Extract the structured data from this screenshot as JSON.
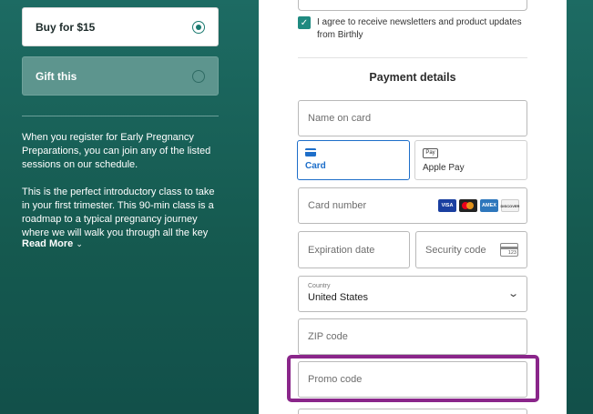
{
  "purchase_options": {
    "buy_label": "Buy for $15",
    "gift_label": "Gift this"
  },
  "description": {
    "paragraph1": "When you register for Early Pregnancy Preparations, you can join any of the listed sessions on our schedule.",
    "paragraph2": "This is the perfect introductory class to take in your first trimester. This 90-min class is a roadmap to a typical pregnancy journey where we will walk you through all the key",
    "read_more": "Read More"
  },
  "newsletter": {
    "checked": true,
    "text": "I agree to receive newsletters and product updates from Birthly"
  },
  "payment": {
    "title": "Payment details",
    "name_placeholder": "Name on card",
    "methods": [
      {
        "label": "Card",
        "selected": true,
        "icon": "credit-card-icon"
      },
      {
        "label": "Apple Pay",
        "selected": false,
        "icon": "apple-pay-icon",
        "icon_text": "Pay"
      }
    ],
    "card_number_placeholder": "Card number",
    "card_brands": [
      {
        "name": "VISA",
        "color": "#1a3fa0"
      },
      {
        "name": "mastercard",
        "color": "#eb001b"
      },
      {
        "name": "AMEX",
        "color": "#2e77bc"
      },
      {
        "name": "DISCOVER",
        "color": "#f2f2f2"
      }
    ],
    "expiration_placeholder": "Expiration date",
    "security_placeholder": "Security code",
    "cvc_icon_text": "123",
    "country_label": "Country",
    "country_value": "United States",
    "zip_placeholder": "ZIP code",
    "promo_placeholder": "Promo code"
  },
  "colors": {
    "accent": "#1f8a80",
    "selected_border": "#1d6ec9",
    "highlight": "#8a268a",
    "background": "#1d6b63"
  }
}
